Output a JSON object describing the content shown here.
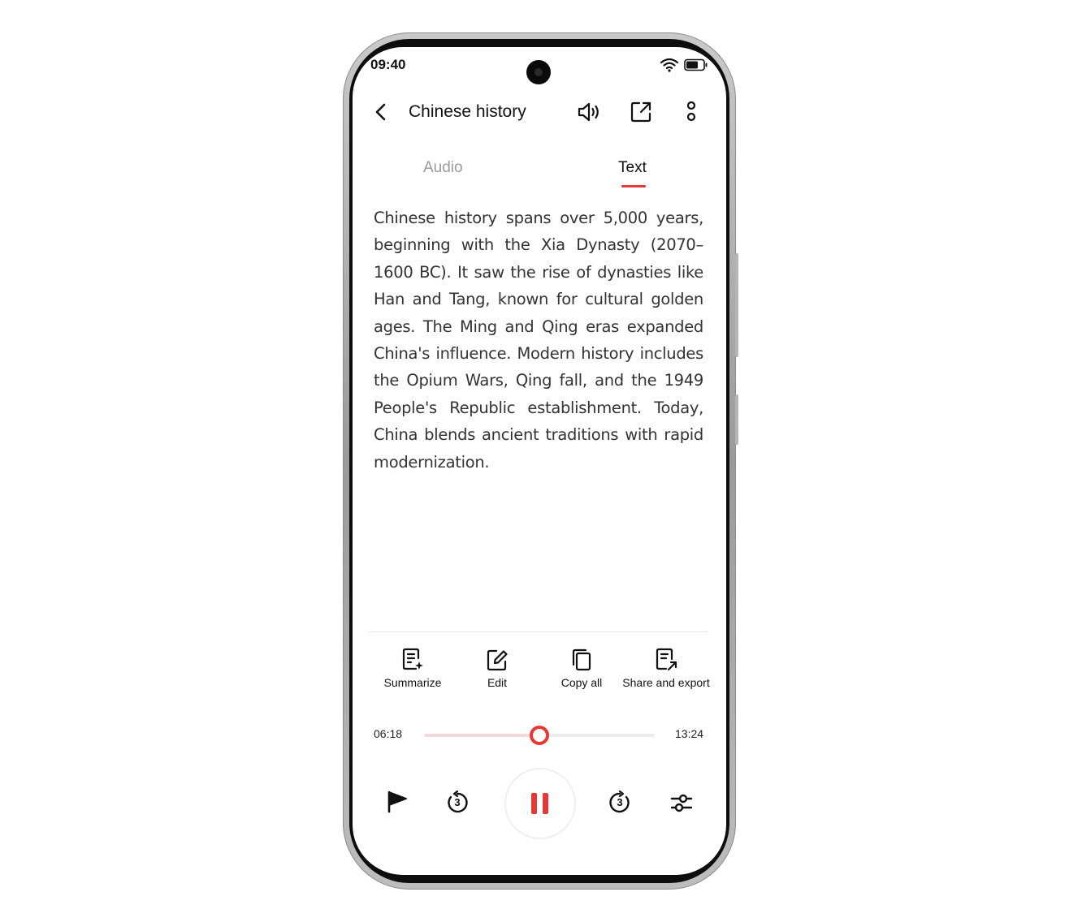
{
  "status_bar": {
    "time": "09:40"
  },
  "header": {
    "title": "Chinese history"
  },
  "tabs": [
    {
      "label": "Audio",
      "active": false
    },
    {
      "label": "Text",
      "active": true
    }
  ],
  "transcript": {
    "text": "Chinese history spans over 5,000 years, beginning with the Xia Dynasty (2070–1600 BC). It saw the rise of dynasties like Han and Tang, known for cultural golden ages. The Ming and Qing eras expanded China's influence. Modern history includes the Opium Wars, Qing fall, and the 1949 People's Republic establishment. Today, China blends ancient traditions with rapid modernization."
  },
  "actions": [
    {
      "label": "Summarize",
      "icon": "summarize-icon"
    },
    {
      "label": "Edit",
      "icon": "edit-icon"
    },
    {
      "label": "Copy all",
      "icon": "copy-icon"
    },
    {
      "label": "Share and export",
      "icon": "share-export-icon"
    }
  ],
  "player": {
    "elapsed": "06:18",
    "duration": "13:24",
    "progress": 0.5,
    "rewind_seconds": "3",
    "forward_seconds": "3",
    "state": "playing"
  },
  "colors": {
    "accent": "#e53935",
    "text_primary": "#111111",
    "text_secondary": "#9a9a9a"
  }
}
